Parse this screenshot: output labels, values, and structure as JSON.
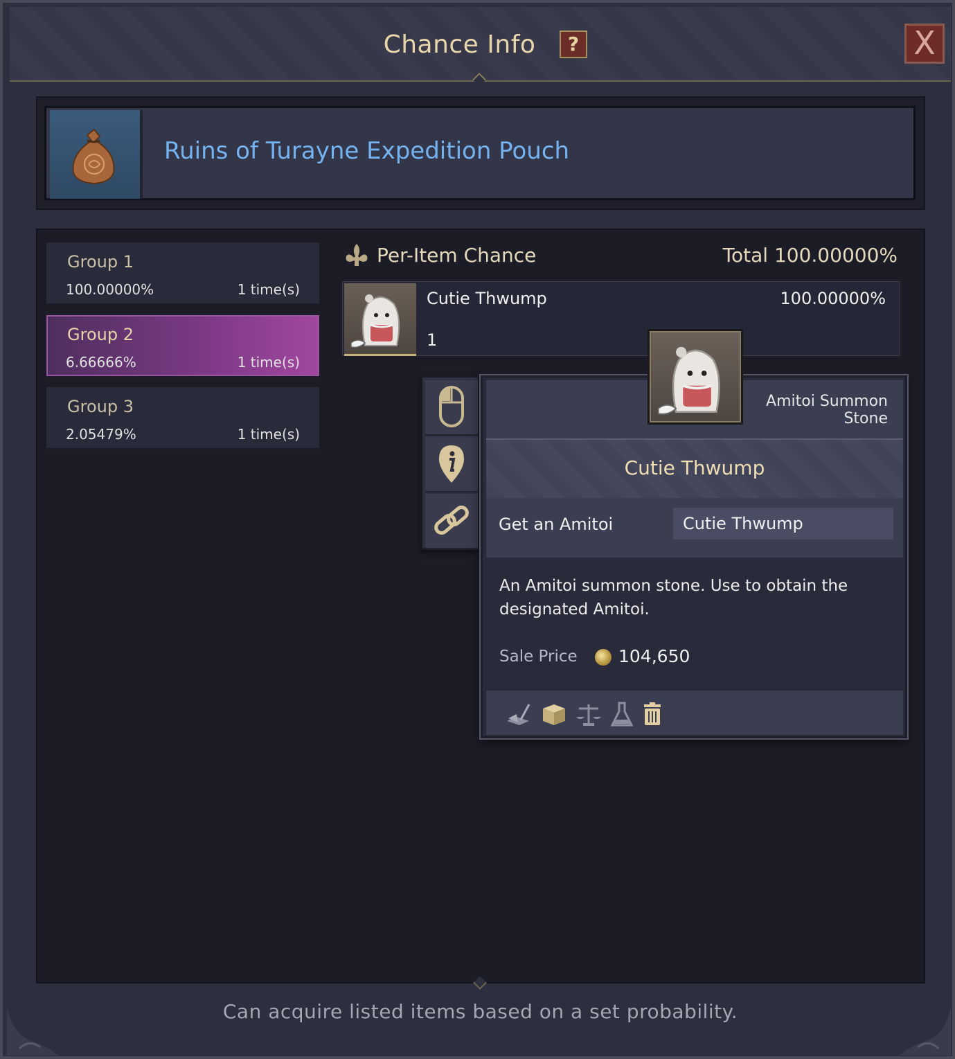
{
  "window": {
    "title": "Chance Info",
    "help_glyph": "?",
    "close_glyph": "X"
  },
  "item": {
    "name": "Ruins of Turayne Expedition Pouch",
    "icon": "pouch-icon"
  },
  "groups": [
    {
      "name": "Group 1",
      "chance": "100.00000%",
      "times": "1 time(s)",
      "selected": false
    },
    {
      "name": "Group 2",
      "chance": "6.66666%",
      "times": "1 time(s)",
      "selected": true
    },
    {
      "name": "Group 3",
      "chance": "2.05479%",
      "times": "1 time(s)",
      "selected": false
    }
  ],
  "per_item": {
    "title": "Per-Item Chance",
    "total": "Total 100.00000%",
    "items": [
      {
        "name": "Cutie Thwump",
        "quantity": "1",
        "chance": "100.00000%",
        "icon": "amitoi-icon"
      }
    ]
  },
  "tooltip": {
    "type": "Amitoi Summon Stone",
    "name": "Cutie Thwump",
    "attr_label": "Get an Amitoi",
    "attr_value": "Cutie Thwump",
    "description": "An Amitoi summon stone. Use to obtain the designated Amitoi.",
    "sale_label": "Sale Price",
    "sale_value": "104,650",
    "footer_icons": [
      "book-icon",
      "storage-box-icon",
      "scales-icon",
      "flask-icon",
      "trash-icon"
    ],
    "actions": [
      "mouse-icon",
      "info-icon",
      "link-icon"
    ]
  },
  "footer": {
    "note": "Can acquire listed items based on a set probability."
  },
  "colors": {
    "title": "#e8d6aa",
    "item_name": "#74b3f0",
    "selected_group": "#7e3a86"
  }
}
